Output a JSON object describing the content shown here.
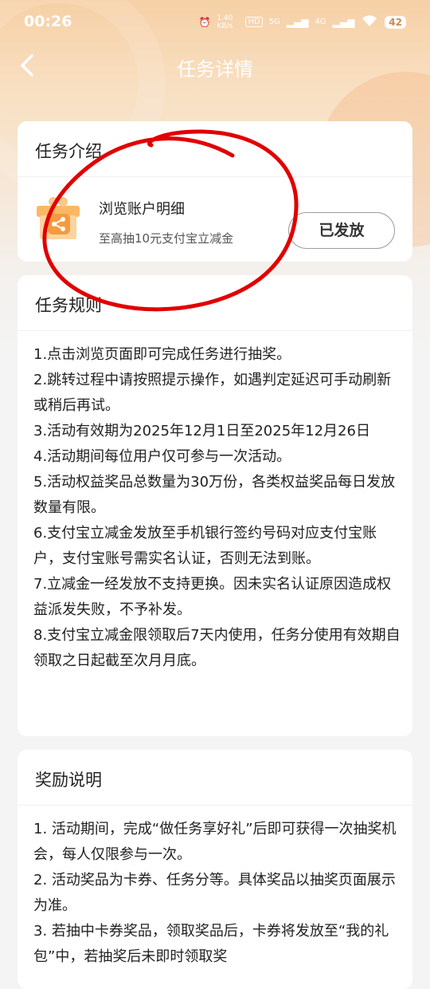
{
  "status_bar": {
    "time": "00:26",
    "net_speed": "1.40 KB/s",
    "sim1": "5G",
    "sim2": "4G",
    "battery": "42"
  },
  "nav": {
    "title": "任务详情"
  },
  "intro": {
    "heading": "任务介绍",
    "task_name": "浏览账户明细",
    "task_desc": "至高抽10元支付宝立减金",
    "button_label": "已发放"
  },
  "rules": {
    "heading": "任务规则",
    "items": [
      "1.点击浏览页面即可完成任务进行抽奖。",
      "2.跳转过程中请按照提示操作，如遇判定延迟可手动刷新或稍后再试。",
      "3.活动有效期为2025年12月1日至2025年12月26日",
      "4.活动期间每位用户仅可参与一次活动。",
      "5.活动权益奖品总数量为30万份，各类权益奖品每日发放数量有限。",
      "6.支付宝立减金发放至手机银行签约号码对应支付宝账户，支付宝账号需实名认证，否则无法到账。",
      "7.立减金一经发放不支持更换。因未实名认证原因造成权益派发失败，不予补发。",
      "8.支付宝立减金限领取后7天内使用，任务分使用有效期自领取之日起截至次月月底。"
    ]
  },
  "rewards": {
    "heading": "奖励说明",
    "items": [
      "1. 活动期间，完成“做任务享好礼”后即可获得一次抽奖机会，每人仅限参与一次。",
      "2. 活动奖品为卡券、任务分等。具体奖品以抽奖页面展示为准。",
      "3. 若抽中卡券奖品，领取奖品后，卡券将发放至“我的礼包”中，若抽奖后未即时领取奖"
    ]
  },
  "colors": {
    "header_gradient_top": "#f6d0a6",
    "annotation_red": "#e10000",
    "gift_orange": "#f5a64a"
  }
}
